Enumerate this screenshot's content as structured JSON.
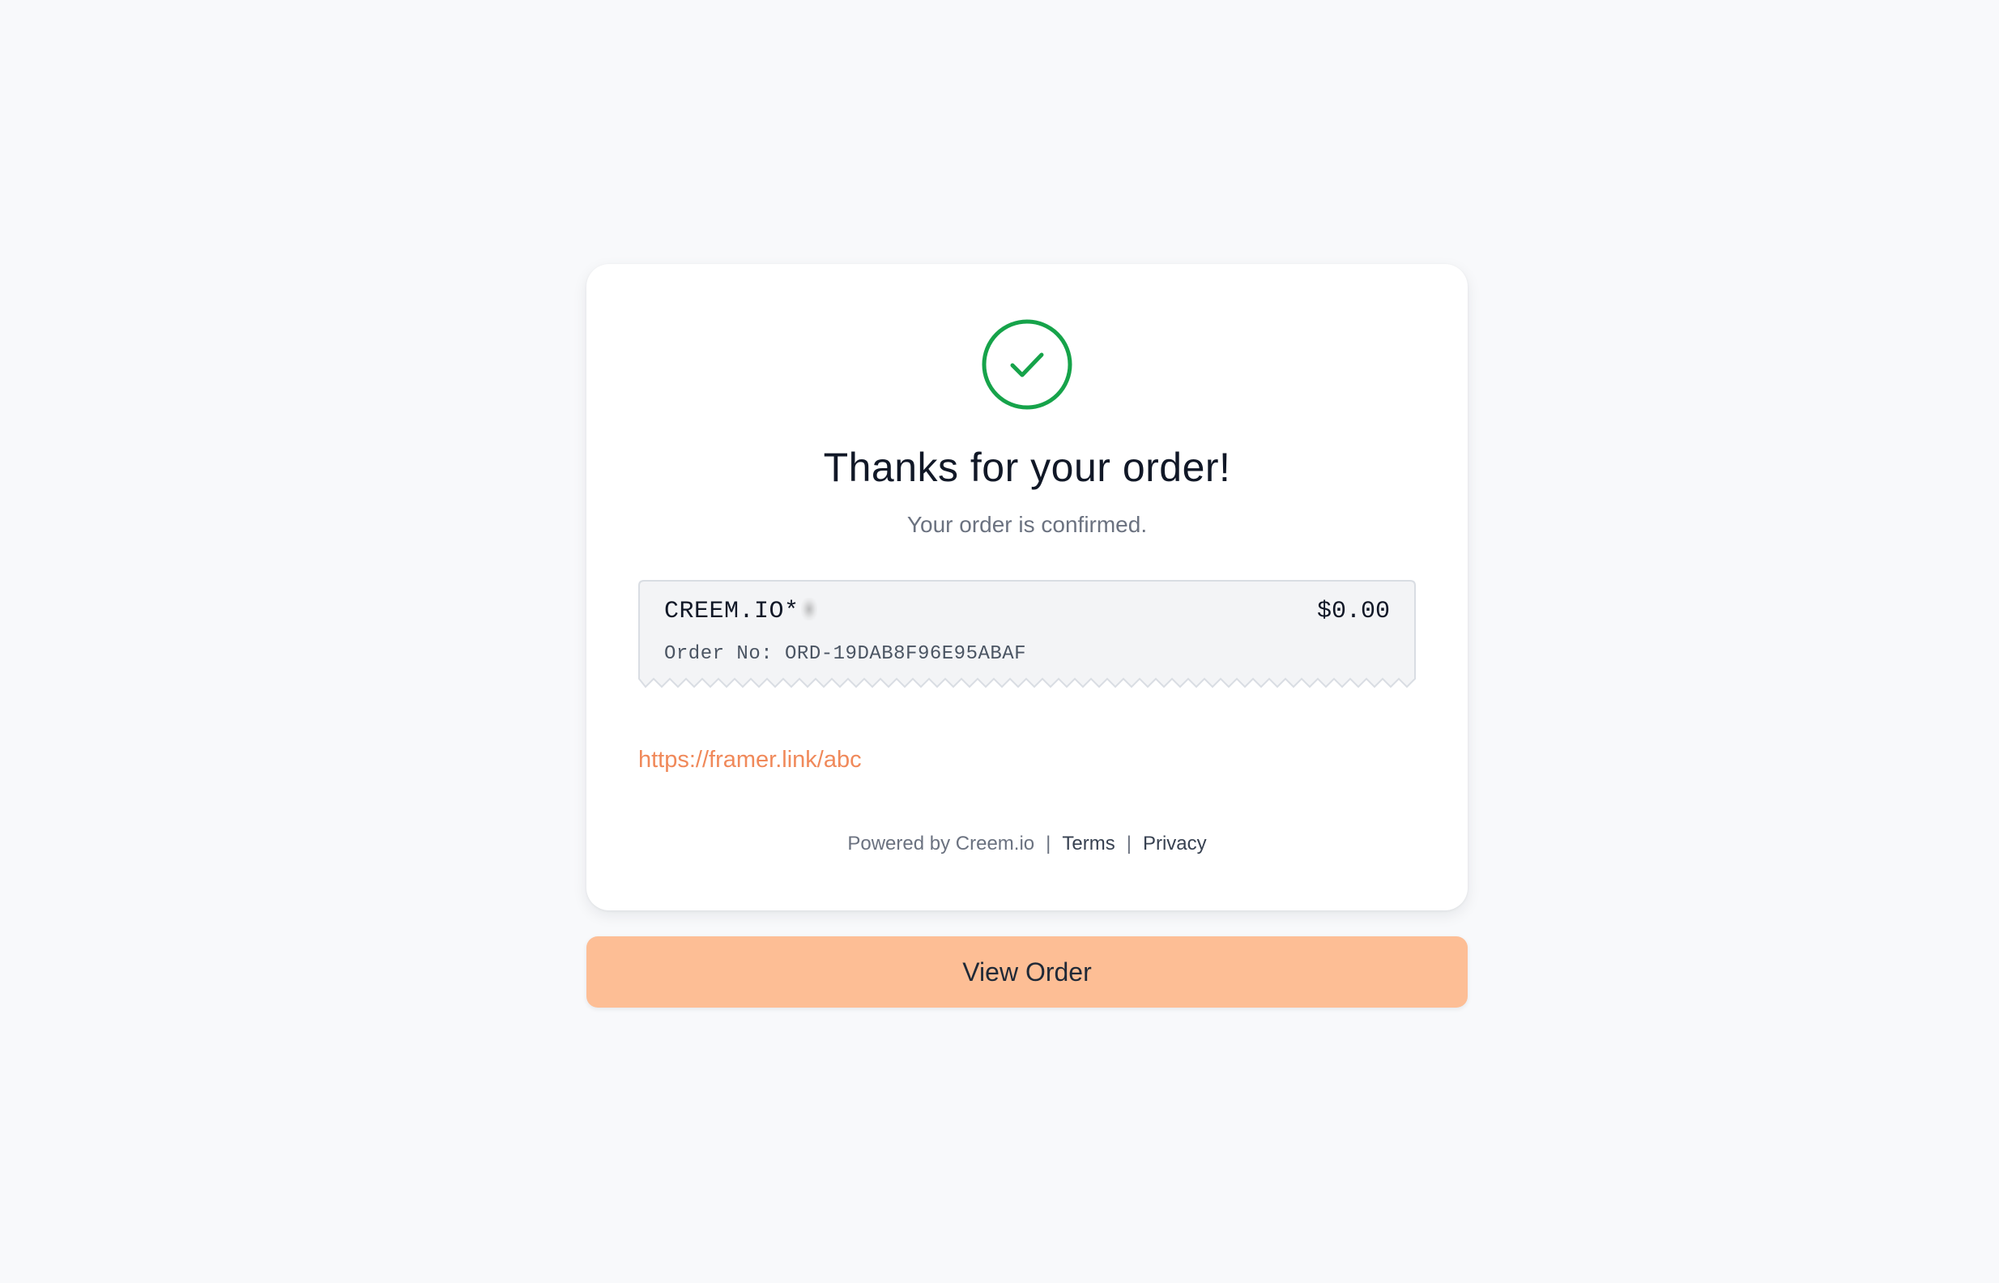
{
  "confirmation": {
    "title": "Thanks for your order!",
    "subtitle": "Your order is confirmed."
  },
  "receipt": {
    "merchant": "CREEM.IO*",
    "amount": "$0.00",
    "order_label": "Order No:",
    "order_number": "ORD-19DAB8F96E95ABAF"
  },
  "product_link": {
    "text": "https://framer.link/abc"
  },
  "footer": {
    "powered_by": "Powered by Creem.io",
    "separator": "|",
    "terms": "Terms",
    "privacy": "Privacy"
  },
  "actions": {
    "view_order_label": "View Order"
  },
  "colors": {
    "page_background": "#f8f9fb",
    "success_green": "#16a34a",
    "link_orange": "#f0895a",
    "button_peach": "#fdbe95",
    "receipt_background": "#f3f4f6"
  },
  "icons": {
    "success": "check-circle-icon"
  }
}
